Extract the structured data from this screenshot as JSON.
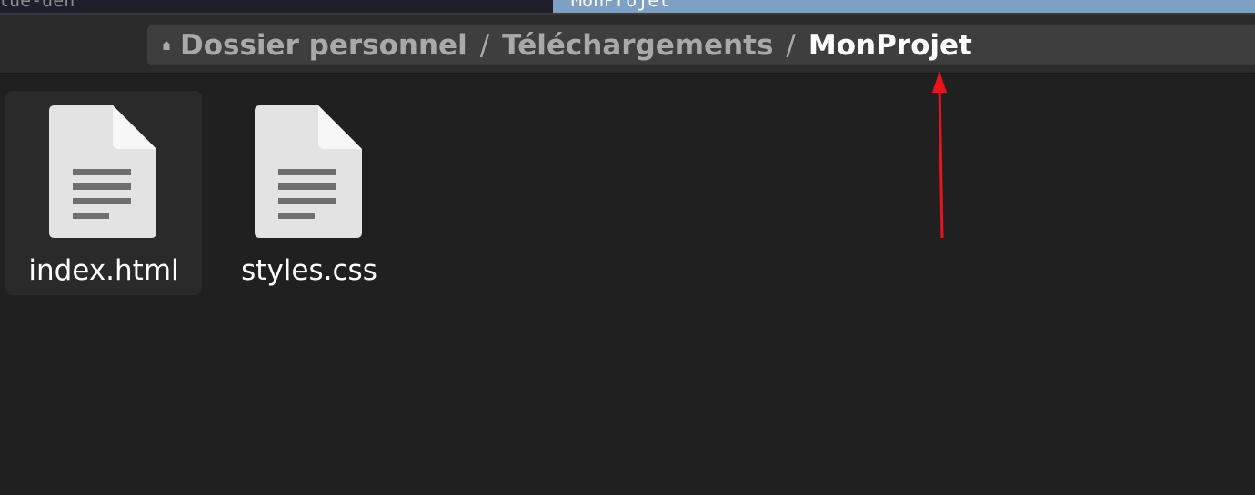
{
  "window": {
    "left_tab_text": "lue-den",
    "right_tab_text": "MonProjet"
  },
  "breadcrumb": {
    "home_icon": "home-icon",
    "items": [
      {
        "label": "Dossier personnel"
      },
      {
        "label": "Téléchargements"
      },
      {
        "label": "MonProjet"
      }
    ],
    "separator": "/"
  },
  "files": [
    {
      "name": "index.html",
      "icon": "text-document-icon",
      "selected": true
    },
    {
      "name": "styles.css",
      "icon": "text-document-icon",
      "selected": false
    }
  ],
  "annotation": {
    "type": "arrow",
    "color": "#e8141c",
    "points_to": "breadcrumb-current"
  }
}
